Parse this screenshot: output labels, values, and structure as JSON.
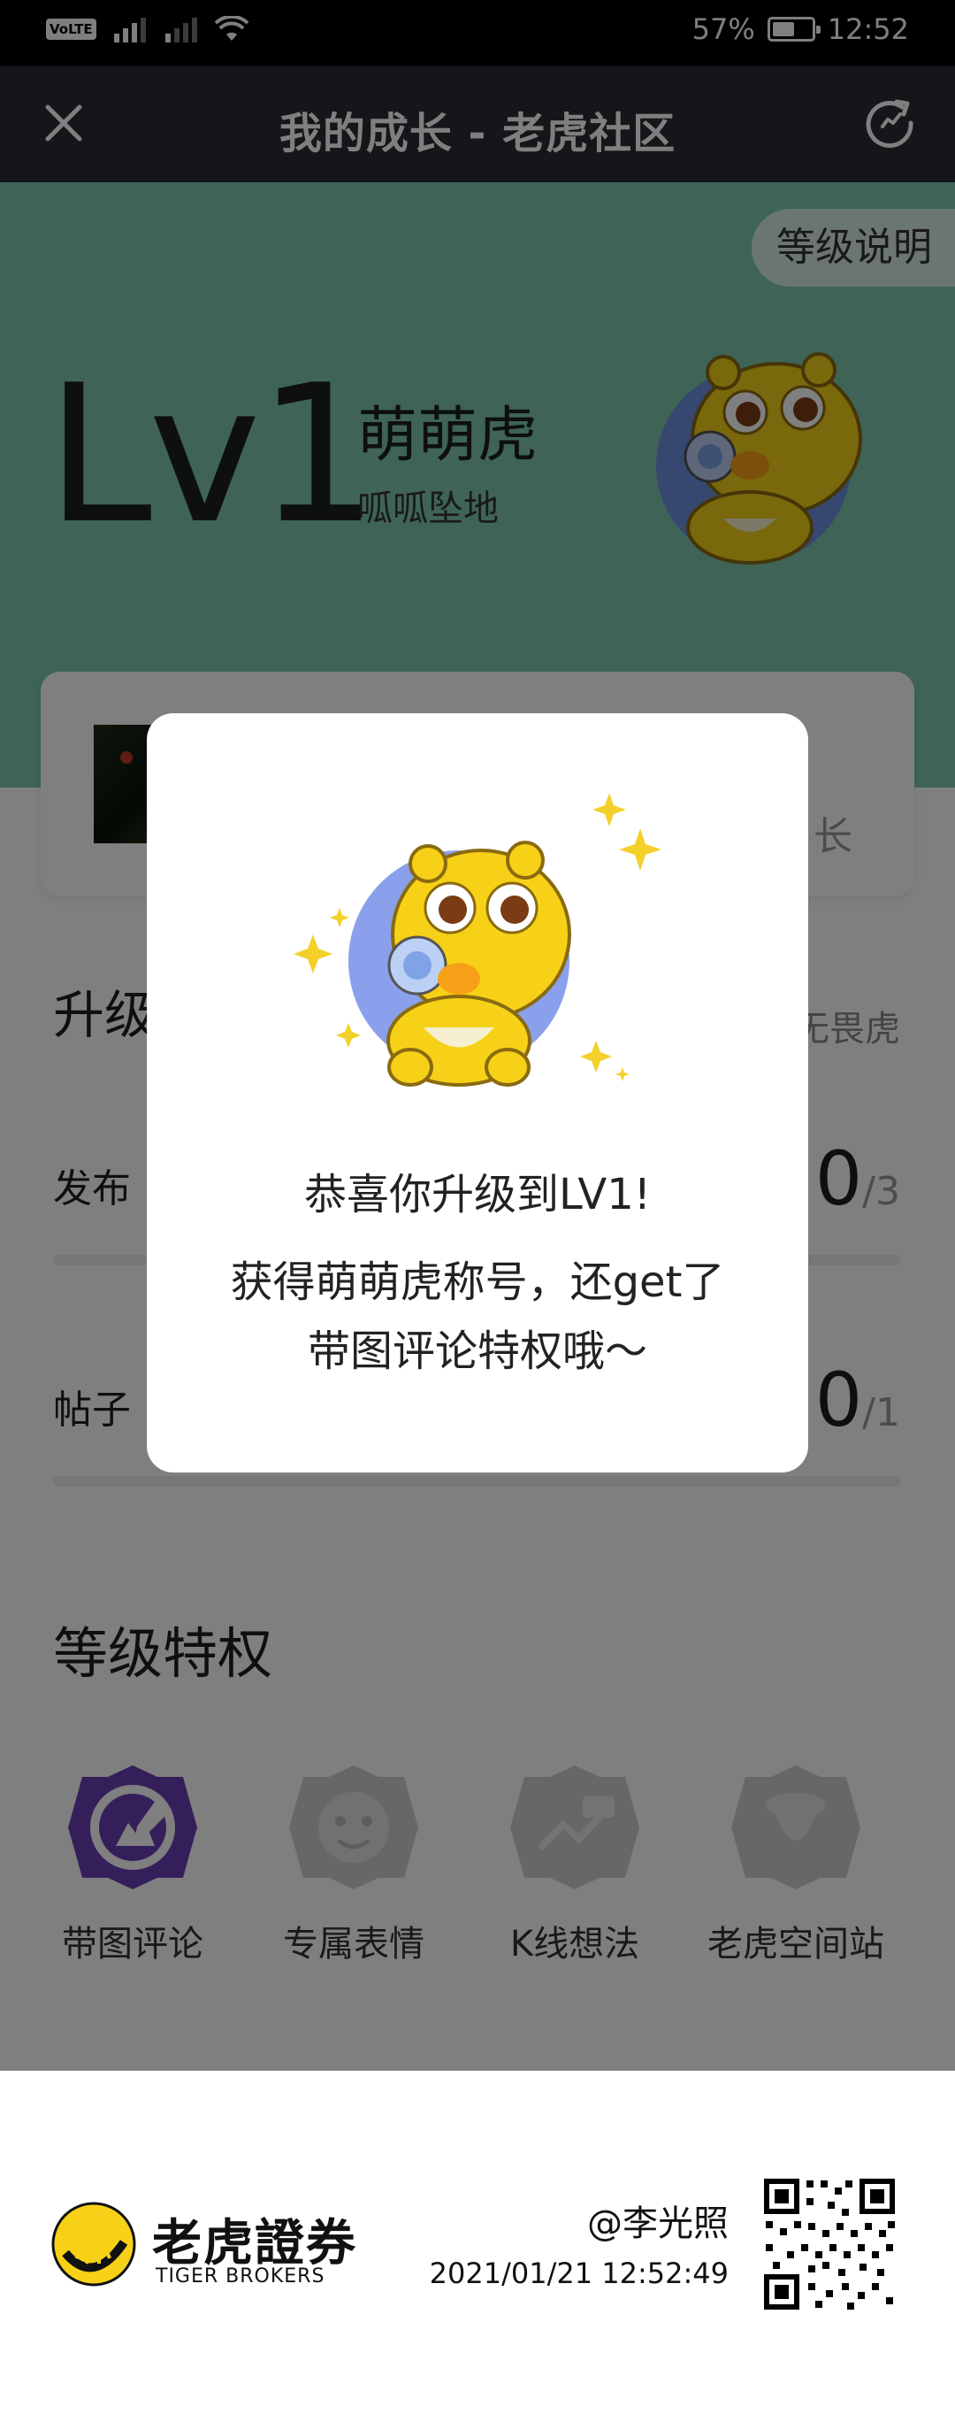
{
  "status_bar": {
    "volte": "VoLTE",
    "battery_text": "57%",
    "battery_level": 0.57,
    "time": "12:52",
    "icons": [
      "signal-icon",
      "signal-roaming-icon",
      "wifi-icon",
      "battery-icon"
    ]
  },
  "nav": {
    "title": "我的成长 - 老虎社区",
    "close_icon": "close-icon",
    "refresh_icon": "refresh-icon"
  },
  "header": {
    "level_help": "等级说明",
    "level": "Lv1",
    "title_name": "萌萌虎",
    "subtitle": "呱呱坠地",
    "bg_color": "#7ec8af"
  },
  "card": {
    "right_text": "长"
  },
  "upgrade": {
    "title": "升级",
    "link": "无畏虎",
    "tasks": [
      {
        "label": "发布",
        "done": "0",
        "total": "/3"
      },
      {
        "label": "帖子",
        "done": "0",
        "total": "/1"
      }
    ]
  },
  "privileges": {
    "title": "等级特权",
    "items": [
      {
        "label": "带图评论",
        "icon": "image-comment-icon",
        "active": true
      },
      {
        "label": "专属表情",
        "icon": "emoji-icon",
        "active": false
      },
      {
        "label": "K线想法",
        "icon": "kline-icon",
        "active": false
      },
      {
        "label": "老虎空间站",
        "icon": "space-station-icon",
        "active": false
      }
    ]
  },
  "footer": {
    "logo_cn": "老虎證券",
    "logo_en": "TIGER BROKERS",
    "user": "@李光照",
    "timestamp": "2021/01/21 12:52:49"
  },
  "modal": {
    "title": "恭喜你升级到LV1!",
    "desc_line1": "获得萌萌虎称号，还get了",
    "desc_line2": "带图评论特权哦～"
  },
  "colors": {
    "accent_purple": "#6a3fb5",
    "tiger_yellow": "#f7d117",
    "nav_bg": "#2a2c32"
  }
}
